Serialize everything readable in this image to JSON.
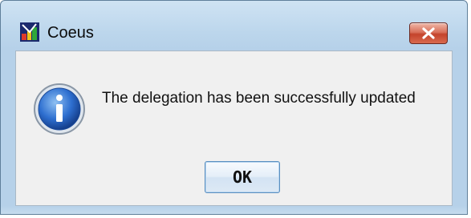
{
  "window": {
    "title": "Coeus",
    "title_icon": "coeus-app-icon",
    "close_icon": "close-icon",
    "close_color": "#c4432c"
  },
  "dialog": {
    "icon": "info-icon",
    "icon_color": "#1f5fb8",
    "message": "The delegation has been successfully updated",
    "ok_label": "OK"
  }
}
